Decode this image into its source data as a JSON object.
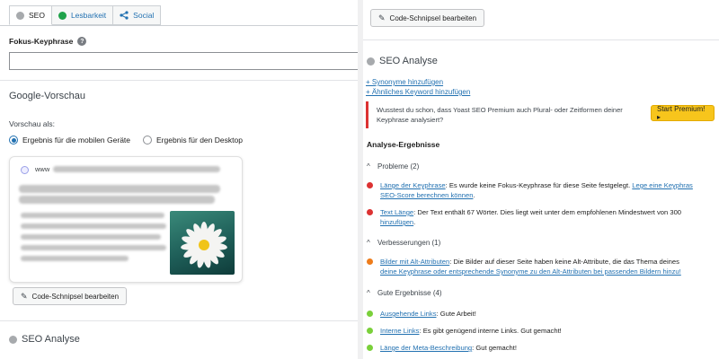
{
  "left": {
    "tabs": [
      {
        "label": "SEO",
        "dot": "#a7aaad"
      },
      {
        "label": "Lesbarkeit",
        "dot": "#1fa24a"
      },
      {
        "label": "Social"
      }
    ],
    "focus_keyphrase": {
      "label": "Fokus-Keyphrase",
      "value": ""
    },
    "google_preview": {
      "title": "Google-Vorschau",
      "preview_as": "Vorschau als:",
      "options": [
        "Ergebnis für die mobilen Geräte",
        "Ergebnis für den Desktop"
      ],
      "selected": 0,
      "serp_www": "www"
    },
    "edit_snippet": "Code-Schnipsel bearbeiten",
    "seo_analysis": "SEO Analyse"
  },
  "right": {
    "edit_snippet": "Code-Schnipsel bearbeiten",
    "seo_analysis": "SEO Analyse",
    "add_synonyms": "+ Synonyme hinzufügen",
    "add_keyword": "+ Ähnliches Keyword hinzufügen",
    "premium_text": "Wusstest du schon, dass Yoast SEO Premium auch Plural- oder Zeitformen deiner Keyphrase analysiert?",
    "premium_button": "Start Premium! ▸",
    "results_title": "Analyse-Ergebnisse",
    "groups": {
      "problems": {
        "title": "Probleme (2)",
        "items": [
          {
            "link": "Länge der Keyphrase",
            "text": ": Es wurde keine Fokus-Keyphrase für diese Seite festgelegt. ",
            "link2": "Lege eine Keyphras",
            "line2": "SEO-Score berechnen können",
            "line2_after": ".",
            "color": "#dc3232"
          },
          {
            "link": "Text Länge",
            "text": ": Der Text enthält 67 Wörter. Dies liegt weit unter dem empfohlenen Mindestwert von 300",
            "line2": "hinzufügen",
            "line2_after": ".",
            "color": "#dc3232"
          }
        ]
      },
      "improvements": {
        "title": "Verbesserungen (1)",
        "items": [
          {
            "link": "Bilder mit Alt-Attributen",
            "text": ": Die Bilder auf dieser Seite haben keine Alt-Attribute, die das Thema deines",
            "line2": "deine Keyphrase oder entsprechende Synonyme zu den Alt-Attributen bei passenden Bildern hinzu!",
            "color": "#ee7c1b"
          }
        ]
      },
      "good": {
        "title": "Gute Ergebnisse (4)",
        "items": [
          {
            "link": "Ausgehende Links",
            "text": ": Gute Arbeit!",
            "color": "#7ad03a"
          },
          {
            "link": "Interne Links",
            "text": ": Es gibt genügend interne Links. Gut gemacht!",
            "color": "#7ad03a"
          },
          {
            "link": "Länge der Meta-Beschreibung",
            "text": ": Gut gemacht!",
            "color": "#7ad03a"
          }
        ]
      }
    }
  }
}
